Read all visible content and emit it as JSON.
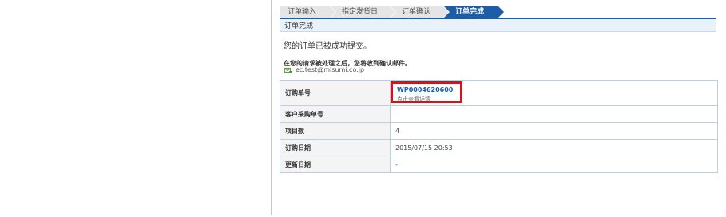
{
  "steps": [
    {
      "label": "订单输入",
      "active": false
    },
    {
      "label": "指定发货日",
      "active": false
    },
    {
      "label": "订单确认",
      "active": false
    },
    {
      "label": "订单完成",
      "active": true
    }
  ],
  "section": {
    "title": "订单完成"
  },
  "message": {
    "success": "您的订单已被成功提交。",
    "notice": "在您的请求被处理之后，您将收到确认邮件。",
    "email": "ec.test@misumi.co.jp",
    "email_icon": "mail-arrow-icon"
  },
  "table": {
    "rows": [
      {
        "label": "订购单号",
        "value": "WP0004620600",
        "sub": "点击查看详情"
      },
      {
        "label": "客户采购单号",
        "value": ""
      },
      {
        "label": "项目数",
        "value": "4"
      },
      {
        "label": "订购日期",
        "value": "2015/07/15 20:53"
      },
      {
        "label": "更新日期",
        "value": "-"
      }
    ]
  },
  "colors": {
    "accent": "#1d5da8",
    "highlight_border": "#d4131b",
    "table_border": "#b8cfe6"
  }
}
